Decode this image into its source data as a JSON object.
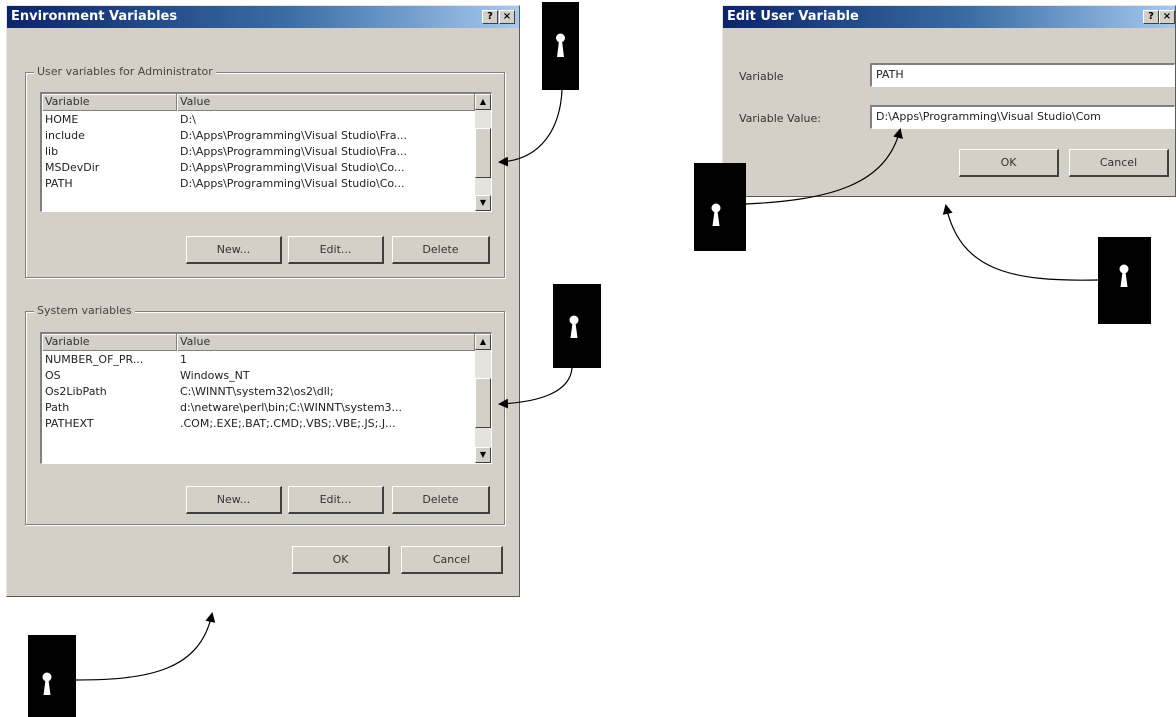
{
  "env_dialog": {
    "title": "Environment Variables",
    "help_btn": "?",
    "close_btn": "×",
    "user_group_label": "User variables for Administrator",
    "user_columns": [
      "Variable",
      "Value"
    ],
    "user_rows": [
      {
        "variable": "HOME",
        "value": "D:\\"
      },
      {
        "variable": "include",
        "value": "D:\\Apps\\Programming\\Visual Studio\\Fra..."
      },
      {
        "variable": "lib",
        "value": "D:\\Apps\\Programming\\Visual Studio\\Fra..."
      },
      {
        "variable": "MSDevDir",
        "value": "D:\\Apps\\Programming\\Visual Studio\\Co..."
      },
      {
        "variable": "PATH",
        "value": "D:\\Apps\\Programming\\Visual Studio\\Co..."
      }
    ],
    "user_buttons": {
      "new": "New...",
      "edit": "Edit...",
      "delete": "Delete"
    },
    "system_group_label": "System variables",
    "system_columns": [
      "Variable",
      "Value"
    ],
    "system_rows": [
      {
        "variable": "NUMBER_OF_PR...",
        "value": "1"
      },
      {
        "variable": "OS",
        "value": "Windows_NT"
      },
      {
        "variable": "Os2LibPath",
        "value": "C:\\WINNT\\system32\\os2\\dll;"
      },
      {
        "variable": "Path",
        "value": "d:\\netware\\perl\\bin;C:\\WINNT\\system3..."
      },
      {
        "variable": "PATHEXT",
        "value": ".COM;.EXE;.BAT;.CMD;.VBS;.VBE;.JS;.J..."
      }
    ],
    "system_buttons": {
      "new": "New...",
      "edit": "Edit...",
      "delete": "Delete"
    },
    "ok": "OK",
    "cancel": "Cancel"
  },
  "edit_dialog": {
    "title": "Edit User Variable",
    "help_btn": "?",
    "close_btn": "×",
    "name_label": "Variable",
    "name_value": "PATH",
    "value_label": "Variable Value:",
    "value_value": "D:\\Apps\\Programming\\Visual Studio\\Com",
    "ok": "OK",
    "cancel": "Cancel"
  },
  "callout_icon": "keyhole-icon"
}
